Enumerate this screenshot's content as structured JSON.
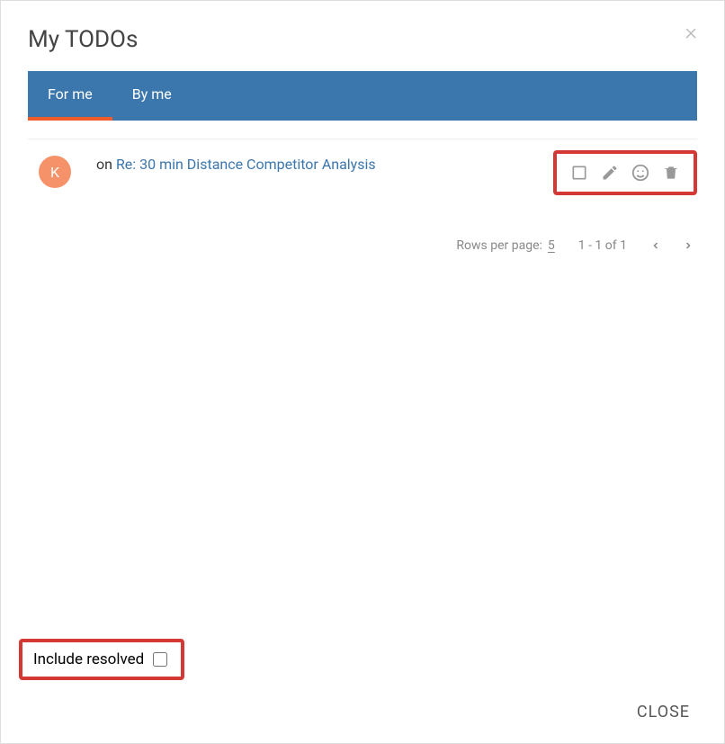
{
  "dialog": {
    "title": "My TODOs"
  },
  "tabs": {
    "for_me": "For me",
    "by_me": "By me"
  },
  "row": {
    "avatar_initial": "K",
    "on_prefix": "on ",
    "link_text": "Re: 30 min Distance Competitor Analysis"
  },
  "pagination": {
    "rows_label": "Rows per page:",
    "rows_value": "5",
    "range_text": "1 - 1 of 1"
  },
  "include": {
    "label": "Include resolved"
  },
  "footer": {
    "close": "CLOSE"
  }
}
